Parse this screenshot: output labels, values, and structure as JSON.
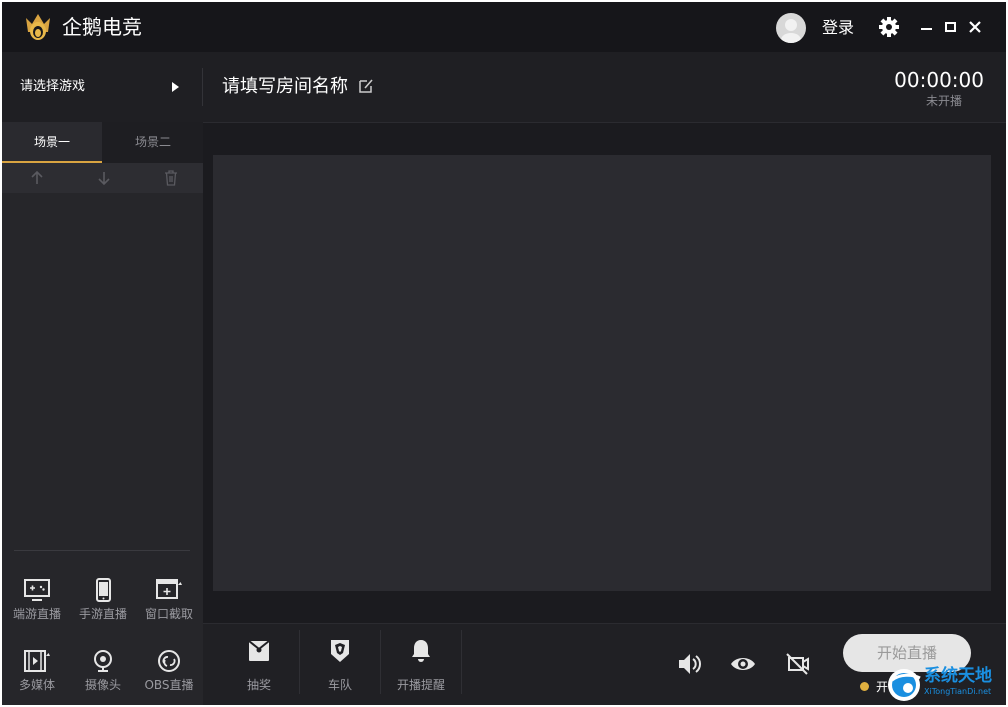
{
  "titlebar": {
    "app_title": "企鹅电竞",
    "login_label": "登录",
    "icons": [
      "logo-icon",
      "avatar",
      "gear-icon",
      "minimize-icon",
      "maximize-icon",
      "close-icon"
    ]
  },
  "header": {
    "game_select_label": "请选择游戏",
    "room_name_placeholder": "请填写房间名称",
    "timer": "00:00:00",
    "timer_status": "未开播"
  },
  "sidebar": {
    "tabs": [
      {
        "label": "场景一",
        "active": true
      },
      {
        "label": "场景二",
        "active": false
      }
    ],
    "scene_tools": [
      "arrow-up-icon",
      "arrow-down-icon",
      "trash-icon"
    ],
    "sources": [
      {
        "label": "端游直播",
        "icon": "pc-game-icon"
      },
      {
        "label": "手游直播",
        "icon": "phone-icon"
      },
      {
        "label": "窗口截取",
        "icon": "window-capture-icon"
      },
      {
        "label": "多媒体",
        "icon": "film-icon"
      },
      {
        "label": "摄像头",
        "icon": "webcam-icon"
      },
      {
        "label": "OBS直播",
        "icon": "obs-icon"
      }
    ]
  },
  "bottombar": {
    "tools": [
      {
        "label": "抽奖",
        "icon": "lottery-icon"
      },
      {
        "label": "车队",
        "icon": "team-icon"
      },
      {
        "label": "开播提醒",
        "icon": "bell-icon"
      }
    ],
    "controls": [
      "volume-icon",
      "eye-icon",
      "mic-off-icon"
    ],
    "start_label": "开始直播",
    "status_text": "开"
  },
  "watermark": {
    "text": "系统天地",
    "sub": "XiTongTianDi.net"
  },
  "colors": {
    "accent": "#d9a441",
    "background": "#1c1c20",
    "canvas": "#2b2b30"
  }
}
